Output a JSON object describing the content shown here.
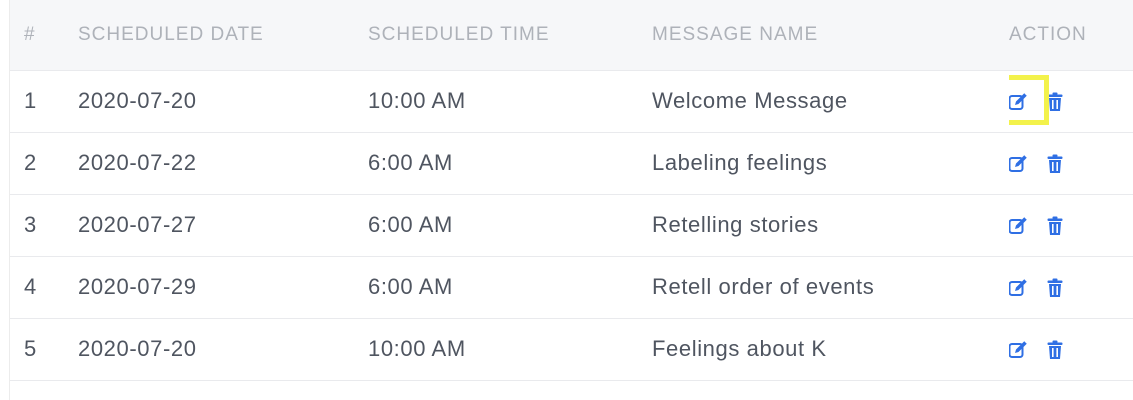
{
  "table": {
    "headers": [
      "#",
      "SCHEDULED DATE",
      "SCHEDULED TIME",
      "MESSAGE NAME",
      "ACTION"
    ],
    "rows": [
      {
        "num": "1",
        "date": "2020-07-20",
        "time": "10:00 AM",
        "name": "Welcome Message"
      },
      {
        "num": "2",
        "date": "2020-07-22",
        "time": "6:00 AM",
        "name": "Labeling feelings"
      },
      {
        "num": "3",
        "date": "2020-07-27",
        "time": "6:00 AM",
        "name": "Retelling stories"
      },
      {
        "num": "4",
        "date": "2020-07-29",
        "time": "6:00 AM",
        "name": "Retell order of events"
      },
      {
        "num": "5",
        "date": "2020-07-20",
        "time": "10:00 AM",
        "name": "Feelings about K"
      }
    ],
    "actions": {
      "edit_icon": "edit-icon",
      "delete_icon": "trash-icon"
    },
    "highlighted_row": 1
  },
  "colors": {
    "accent_blue": "#2f6fe4",
    "highlight_yellow": "#f3f24b",
    "header_text": "#aeb2b9",
    "body_text": "#4f5560"
  }
}
